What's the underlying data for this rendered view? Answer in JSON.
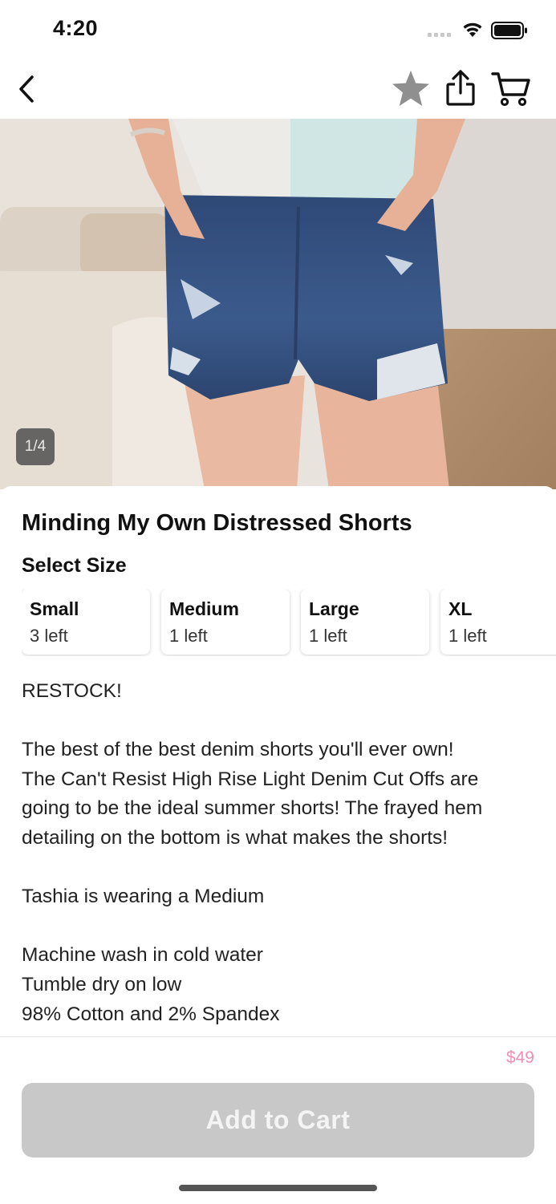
{
  "status_bar": {
    "time": "4:20"
  },
  "nav": {
    "back_icon": "chevron-left-icon",
    "favorite_icon": "star-icon",
    "share_icon": "share-icon",
    "cart_icon": "cart-icon"
  },
  "gallery": {
    "counter": "1/4"
  },
  "product": {
    "title": "Minding My Own Distressed Shorts",
    "select_size_label": "Select Size",
    "sizes": [
      {
        "name": "Small",
        "stock": "3 left"
      },
      {
        "name": "Medium",
        "stock": "1 left"
      },
      {
        "name": "Large",
        "stock": "1 left"
      },
      {
        "name": "XL",
        "stock": "1 left"
      }
    ],
    "description": [
      "RESTOCK!",
      "",
      "The best of the best denim shorts you'll ever own!",
      "The Can't Resist High Rise Light Denim Cut Offs are",
      "going to be the ideal summer shorts! The frayed hem",
      "detailing on the bottom is what makes the shorts!",
      "",
      "Tashia is wearing a Medium",
      "",
      "Machine wash in cold water",
      "Tumble dry on low",
      "98% Cotton and 2% Spandex"
    ]
  },
  "footer": {
    "price": "$49",
    "add_to_cart_label": "Add to Cart",
    "add_to_cart_color": "#c8c8c8",
    "price_color": "#ef8fb5"
  }
}
